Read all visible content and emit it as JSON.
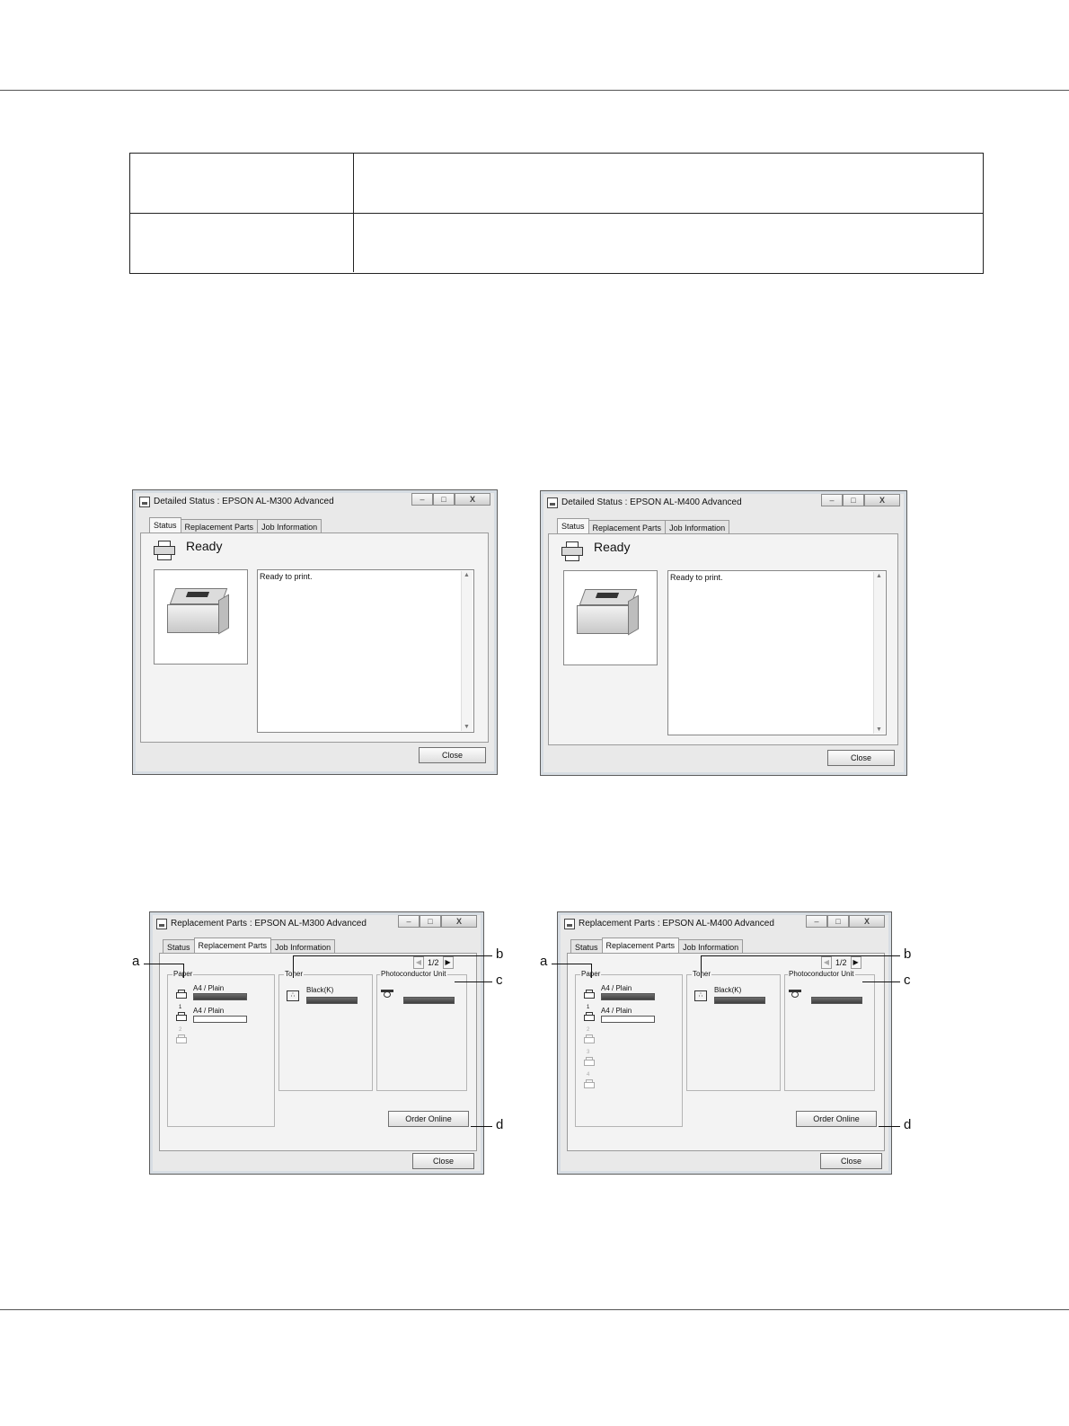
{
  "status_dialogs": [
    {
      "title": "Detailed Status : EPSON AL-M300 Advanced",
      "tabs": [
        "Status",
        "Replacement Parts",
        "Job Information"
      ],
      "status_text": "Ready",
      "message": "Ready to print.",
      "close_label": "Close"
    },
    {
      "title": "Detailed Status : EPSON AL-M400 Advanced",
      "tabs": [
        "Status",
        "Replacement Parts",
        "Job Information"
      ],
      "status_text": "Ready",
      "message": "Ready to print.",
      "close_label": "Close"
    }
  ],
  "parts_dialogs": [
    {
      "title": "Replacement Parts : EPSON AL-M300 Advanced",
      "tabs": [
        "Status",
        "Replacement Parts",
        "Job Information"
      ],
      "pager": "1/2",
      "paper_label": "Paper",
      "toner_label": "Toner",
      "pcu_label": "Photoconductor Unit",
      "trays": [
        {
          "num": "",
          "label": "A4 / Plain",
          "fill": 1.0
        },
        {
          "num": "1",
          "label": "A4 / Plain",
          "fill": 0.0
        },
        {
          "num": "2",
          "label": "",
          "fill": null
        }
      ],
      "toner_name": "Black(K)",
      "toner_level": 1.0,
      "pcu_level": 1.0,
      "order_label": "Order Online",
      "close_label": "Close"
    },
    {
      "title": "Replacement Parts : EPSON AL-M400 Advanced",
      "tabs": [
        "Status",
        "Replacement Parts",
        "Job Information"
      ],
      "pager": "1/2",
      "paper_label": "Paper",
      "toner_label": "Toner",
      "pcu_label": "Photoconductor Unit",
      "trays": [
        {
          "num": "",
          "label": "A4 / Plain",
          "fill": 1.0
        },
        {
          "num": "1",
          "label": "A4 / Plain",
          "fill": 0.0
        },
        {
          "num": "2",
          "label": "",
          "fill": null
        },
        {
          "num": "3",
          "label": "",
          "fill": null
        },
        {
          "num": "4",
          "label": "",
          "fill": null
        }
      ],
      "toner_name": "Black(K)",
      "toner_level": 1.0,
      "pcu_level": 1.0,
      "order_label": "Order Online",
      "close_label": "Close"
    }
  ],
  "callouts": [
    "a",
    "b",
    "c",
    "d"
  ]
}
